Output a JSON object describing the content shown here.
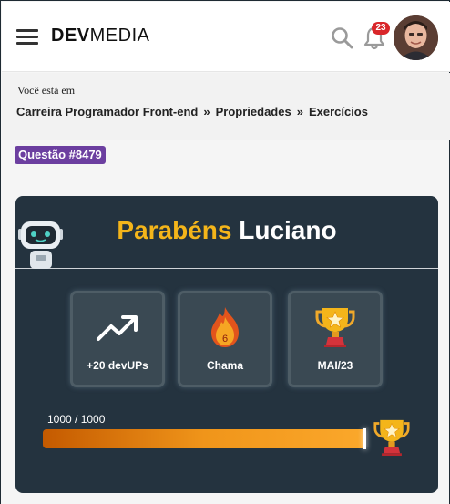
{
  "header": {
    "logo_bold": "DEV",
    "logo_light": "MEDIA",
    "notifications_count": "23"
  },
  "breadcrumb": {
    "intro": "Você está em",
    "items": [
      "Carreira Programador Front-end",
      "Propriedades",
      "Exercícios"
    ],
    "separator": "»"
  },
  "question": {
    "tag": "Questão #8479"
  },
  "result_card": {
    "title_greeting": "Parabéns",
    "title_name": "Luciano",
    "tiles": [
      {
        "icon": "trending-up-icon",
        "label": "+20 devUPs"
      },
      {
        "icon": "flame-icon",
        "label": "Chama",
        "value": "6"
      },
      {
        "icon": "trophy-icon",
        "label": "MAI/23"
      }
    ],
    "progress": {
      "text": "1000 / 1000",
      "current": 1000,
      "max": 1000
    }
  },
  "colors": {
    "accent_yellow": "#f4b51a",
    "card_bg": "#24333f",
    "tag_purple": "#6c3fa0",
    "badge_red": "#d9262a"
  }
}
